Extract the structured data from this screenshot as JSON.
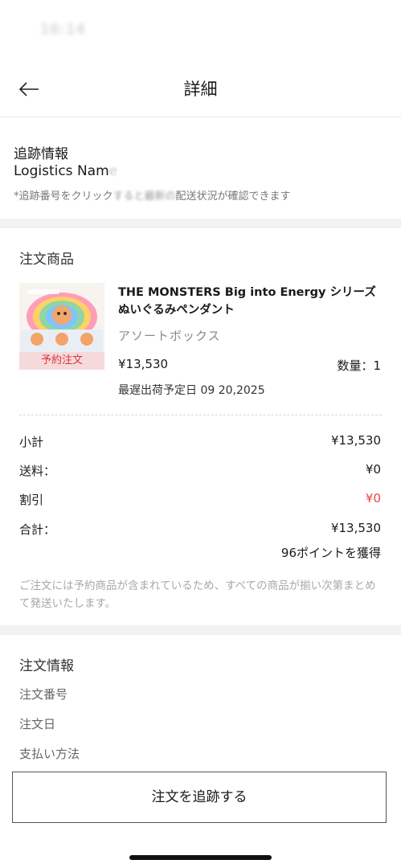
{
  "status_bar": {
    "time": "16:14"
  },
  "header": {
    "title": "詳細"
  },
  "tracking": {
    "title": "追跡情報",
    "logistics_visible": "Logistics Nam",
    "logistics_faded": "e",
    "note_visible": "*追跡番号をクリック",
    "note_faded": "すると最新の",
    "note_rest": "配送状況が確認できます"
  },
  "products": {
    "section_title": "注文商品",
    "item": {
      "name": "THE MONSTERS Big into Energy シリーズ ぬいぐるみペンダント",
      "variant": "アソートボックス",
      "price": "¥13,530",
      "quantity": "数量：1",
      "ship_date": "最遅出荷予定日 09 20,2025",
      "badge": "予約注文"
    },
    "summary": {
      "subtotal_label": "小計",
      "subtotal_value": "¥13,530",
      "shipping_label": "送料：",
      "shipping_value": "¥0",
      "discount_label": "割引",
      "discount_value": "¥0",
      "total_label": "合計：",
      "total_value": "¥13,530",
      "points": "96ポイントを獲得"
    },
    "notice": "ご注文には予約商品が含まれているため、すべての商品が揃い次第まとめて発送いたします。"
  },
  "order_info": {
    "title": "注文情報",
    "order_number_label": "注文番号",
    "order_date_label": "注文日",
    "payment_label": "支払い方法"
  },
  "buttons": {
    "track_order": "注文を追跡する"
  },
  "colors": {
    "accent_red": "#e0454c",
    "badge_bg": "#f6d9da",
    "divider": "#f2f2f2"
  },
  "icons": {
    "back": "arrow-left-icon"
  }
}
